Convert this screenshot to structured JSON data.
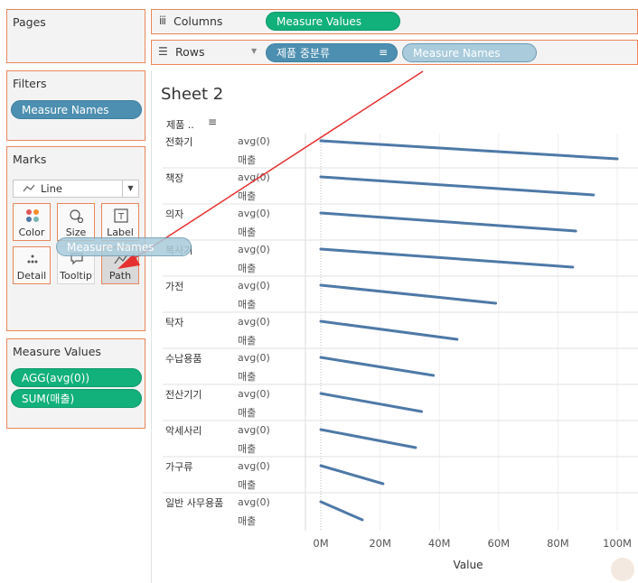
{
  "left": {
    "pages_title": "Pages",
    "filters_title": "Filters",
    "filter_pill": "Measure Names",
    "marks_title": "Marks",
    "mark_type": "Line",
    "mark_buttons": [
      "Color",
      "Size",
      "Label",
      "Detail",
      "Tooltip",
      "Path"
    ],
    "measure_values_title": "Measure Values",
    "measure_pills": [
      "AGG(avg(0))",
      "SUM(매출)"
    ]
  },
  "shelves": {
    "columns_label": "Columns",
    "columns_pill": "Measure Values",
    "rows_label": "Rows",
    "rows_pills": [
      "제품 중분류",
      "Measure Names"
    ]
  },
  "drag_pill": "Measure Names",
  "sheet": {
    "title": "Sheet 2",
    "header": "제품 ..",
    "measures": [
      "avg(0)",
      "매출"
    ],
    "axis_title": "Value"
  },
  "chart_data": {
    "type": "line",
    "categories": [
      "전화기",
      "책장",
      "의자",
      "복사기",
      "가전",
      "탁자",
      "수납용품",
      "전산기기",
      "악세사리",
      "가구류",
      "일반 사무용품"
    ],
    "series": [
      {
        "name": "avg(0)",
        "values": [
          0,
          0,
          0,
          0,
          0,
          0,
          0,
          0,
          0,
          0,
          0
        ]
      },
      {
        "name": "매출",
        "values": [
          100,
          92,
          86,
          85,
          59,
          46,
          38,
          34,
          32,
          21,
          14
        ]
      }
    ],
    "unit": "M",
    "ticks": [
      "0M",
      "20M",
      "40M",
      "60M",
      "80M",
      "100M"
    ],
    "xlim": [
      0,
      105
    ],
    "xlabel": "Value",
    "grid": true,
    "color": "#4e79a7"
  },
  "colors": {
    "accent_border": "#e8875a",
    "pill_green": "#12b07a",
    "pill_blue": "#4d8fb0",
    "arrow": "#e53030"
  }
}
